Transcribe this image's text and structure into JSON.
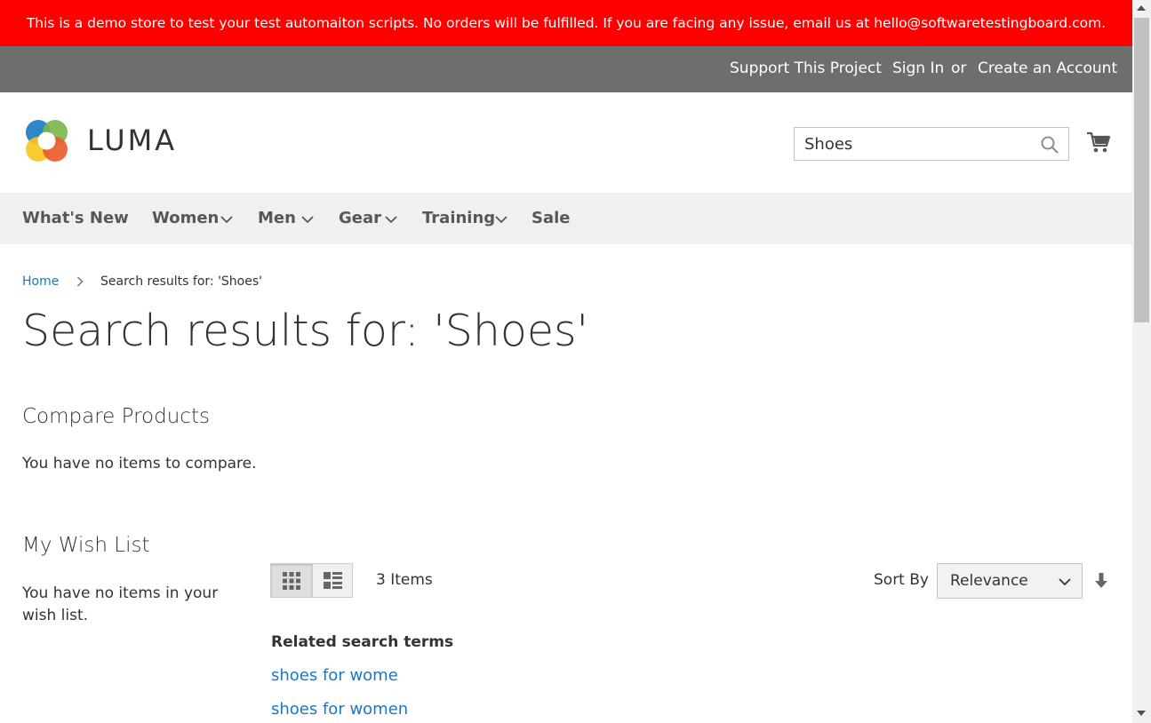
{
  "banner": {
    "text": "This is a demo store to test your test automaiton scripts. No orders will be fulfilled. If you are facing any issue, email us at hello@softwaretestingboard.com."
  },
  "topbar": {
    "support": "Support This Project",
    "sign_in": "Sign In",
    "or": "or",
    "create_account": "Create an Account"
  },
  "header": {
    "logo_text": "LUMA",
    "search_value": "Shoes"
  },
  "nav": {
    "items": [
      {
        "label": "What's New"
      },
      {
        "label": "Women"
      },
      {
        "label": "Men"
      },
      {
        "label": "Gear"
      },
      {
        "label": "Training"
      },
      {
        "label": "Sale"
      }
    ]
  },
  "breadcrumb": {
    "home": "Home",
    "current": "Search results for: 'Shoes'"
  },
  "page_title": "Search results for: 'Shoes'",
  "sidebar": {
    "compare_title": "Compare Products",
    "compare_text": "You have no items to compare.",
    "wishlist_title": "My Wish List",
    "wishlist_text": "You have no items in your wish list."
  },
  "toolbar": {
    "item_count": "3 Items",
    "sort_label": "Sort By",
    "sort_value": "Relevance"
  },
  "related": {
    "title": "Related search terms",
    "terms": [
      "shoes for wome",
      "shoes for women"
    ]
  },
  "colors": {
    "banner": "#ff0000",
    "topbar": "#6e6e6e",
    "nav": "#f0f0f0",
    "link": "#1979c3"
  }
}
